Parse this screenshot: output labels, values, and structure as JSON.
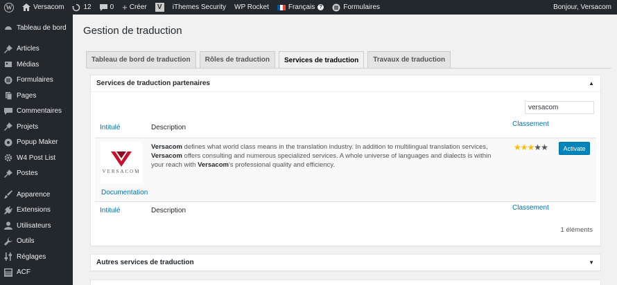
{
  "adminbar": {
    "site_name": "Versacom",
    "updates_count": "12",
    "comments_count": "0",
    "new_label": "Créer",
    "plugin_v": "V",
    "ithemes": "iThemes Security",
    "wprocket": "WP Rocket",
    "language": "Français",
    "forms": "Formulaires",
    "greeting": "Bonjour, Versacom"
  },
  "sidebar": {
    "items": [
      {
        "label": "Tableau de bord",
        "icon": "dashboard-icon"
      },
      {
        "label": "Articles",
        "icon": "pin-icon"
      },
      {
        "label": "Médias",
        "icon": "media-icon"
      },
      {
        "label": "Formulaires",
        "icon": "forms-icon"
      },
      {
        "label": "Pages",
        "icon": "page-icon"
      },
      {
        "label": "Commentaires",
        "icon": "comment-icon"
      },
      {
        "label": "Projets",
        "icon": "pin-icon"
      },
      {
        "label": "Popup Maker",
        "icon": "popup-icon"
      },
      {
        "label": "W4 Post List",
        "icon": "gear-icon"
      },
      {
        "label": "Postes",
        "icon": "pin-icon"
      },
      {
        "label": "Apparence",
        "icon": "brush-icon"
      },
      {
        "label": "Extensions",
        "icon": "plug-icon"
      },
      {
        "label": "Utilisateurs",
        "icon": "user-icon"
      },
      {
        "label": "Outils",
        "icon": "wrench-icon"
      },
      {
        "label": "Réglages",
        "icon": "settings-icon"
      },
      {
        "label": "ACF",
        "icon": "grid-icon"
      }
    ]
  },
  "page": {
    "title": "Gestion de traduction",
    "tabs": [
      {
        "label": "Tableau de bord de traduction"
      },
      {
        "label": "Rôles de traduction"
      },
      {
        "label": "Services de traduction"
      },
      {
        "label": "Travaux de traduction"
      }
    ]
  },
  "partners_box": {
    "title": "Services de traduction partenaires",
    "search_value": "versacom",
    "col_title": "Intitulé",
    "col_description": "Description",
    "col_rating": "Classement",
    "service": {
      "logo_text": "VERSACOM",
      "desc_1_bold": "Versacom",
      "desc_1": " defines what world class means in the translation industry. In addition to multilingual translation services, ",
      "desc_2_bold": "Versacom",
      "desc_2": " offers consulting and numerous specialized services. A whole universe of languages and dialects is within your reach with ",
      "desc_3_bold": "Versacom",
      "desc_3": "'s professional quality and efficiency.",
      "rating": 3,
      "rating_max": 5,
      "activate_label": "Activate",
      "documentation_label": "Documentation"
    },
    "count_label": "1 éléments"
  },
  "other_box": {
    "title": "Autres services de traduction"
  },
  "colors": {
    "accent": "#0073aa",
    "button": "#0085ba",
    "star": "#ffb900",
    "adminbar": "#23282d",
    "logo_red": "#c8102e"
  }
}
